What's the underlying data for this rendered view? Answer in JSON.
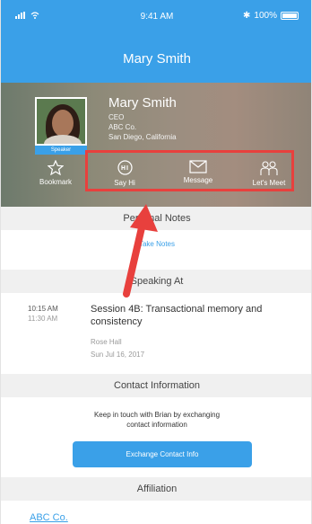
{
  "status_bar": {
    "time": "9:41 AM",
    "battery": "100%"
  },
  "nav": {
    "title": "Mary Smith"
  },
  "profile": {
    "name": "Mary Smith",
    "title": "CEO",
    "company": "ABC Co.",
    "location": "San Diego, California",
    "badge": "Speaker"
  },
  "actions": [
    {
      "label": "Bookmark",
      "icon": "star-icon"
    },
    {
      "label": "Say Hi",
      "icon": "chat-bubble-icon"
    },
    {
      "label": "Message",
      "icon": "envelope-icon"
    },
    {
      "label": "Let's Meet",
      "icon": "people-icon"
    }
  ],
  "personal_notes": {
    "heading": "Personal Notes",
    "take_notes": "Take Notes"
  },
  "speaking_at": {
    "heading": "Speaking At",
    "start_time": "10:15 AM",
    "end_time": "11:30 AM",
    "session_title": "Session 4B: Transactional memory and consistency",
    "room": "Rose Hall",
    "date": "Sun Jul 16, 2017"
  },
  "contact": {
    "heading": "Contact Information",
    "text_line1": "Keep in touch with Brian by exchanging",
    "text_line2": "contact information",
    "button": "Exchange Contact Info"
  },
  "affiliation": {
    "heading": "Affiliation",
    "company": "ABC Co."
  },
  "colors": {
    "accent": "#3aa0e8",
    "highlight": "#e8403d"
  }
}
